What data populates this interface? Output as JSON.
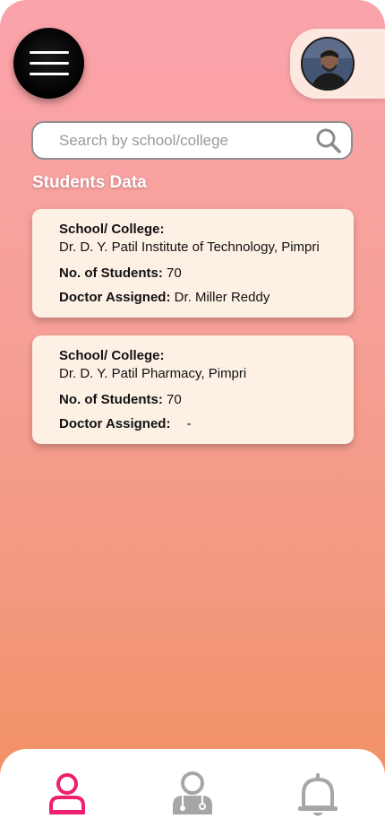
{
  "header": {
    "menu_icon": "hamburger-menu-icon",
    "avatar_icon": "user-photo"
  },
  "search": {
    "placeholder": "Search by school/college",
    "value": "",
    "icon": "search-icon"
  },
  "section_title": "Students Data",
  "cards": [
    {
      "school_label": "School/ College:",
      "school_name": "Dr. D. Y. Patil Institute of Technology, Pimpri",
      "students_label": "No. of Students:",
      "students_value": "70",
      "doctor_label": "Doctor Assigned:",
      "doctor_value": "Dr. Miller Reddy"
    },
    {
      "school_label": "School/ College:",
      "school_name": "Dr. D. Y. Patil Pharmacy, Pimpri",
      "students_label": "No. of Students:",
      "students_value": "70",
      "doctor_label": "Doctor Assigned:",
      "doctor_value": "-"
    }
  ],
  "bottom_nav": [
    {
      "icon": "student-icon",
      "active": true,
      "color": "#ee1f6e"
    },
    {
      "icon": "doctor-icon",
      "active": false,
      "color": "#a6a6a6"
    },
    {
      "icon": "bell-icon",
      "active": false,
      "color": "#a6a6a6"
    }
  ],
  "colors": {
    "gradient_top": "#fba3ab",
    "gradient_bottom": "#f08f5c",
    "card_bg": "#fdf1e6",
    "active_nav": "#ee1f6e",
    "inactive_nav": "#a6a6a6"
  }
}
